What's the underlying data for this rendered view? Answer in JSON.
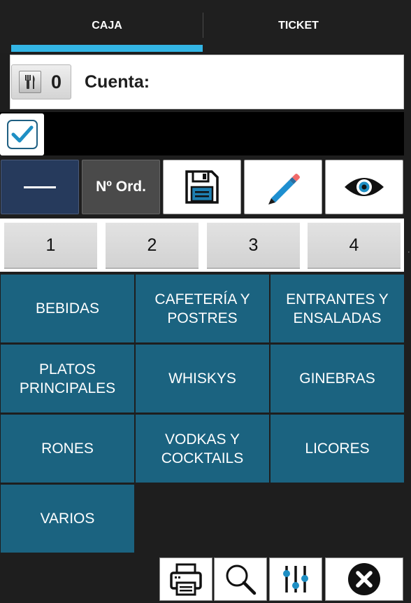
{
  "tabs": [
    {
      "label": "CAJA",
      "active": true
    },
    {
      "label": "TICKET",
      "active": false
    }
  ],
  "colors": {
    "tab_indicator": "#33b5e5",
    "category_bg": "#1b6380",
    "minus_button_bg": "#263a5c",
    "order_button_bg": "#4a4a4a"
  },
  "account": {
    "table_icon": "fork-knife-icon",
    "table_number": "0",
    "label": "Cuenta:",
    "value": ""
  },
  "selection": {
    "checked": true
  },
  "actions": {
    "minus_icon": "minus-icon",
    "order_label": "Nº Ord.",
    "save_icon": "floppy-disk-icon",
    "edit_icon": "pencil-icon",
    "view_icon": "eye-icon"
  },
  "numbers": [
    "1",
    "2",
    "3",
    "4"
  ],
  "categories": [
    "BEBIDAS",
    "CAFETERÍA Y\nPOSTRES",
    "ENTRANTES Y\nENSALADAS",
    "PLATOS\nPRINCIPALES",
    "WHISKYS",
    "GINEBRAS",
    "RONES",
    "VODKAS Y\nCOCKTAILS",
    "LICORES",
    "VARIOS"
  ],
  "toolbar": {
    "print_icon": "printer-icon",
    "search_icon": "search-icon",
    "settings_icon": "sliders-icon",
    "close_icon": "close-icon"
  }
}
